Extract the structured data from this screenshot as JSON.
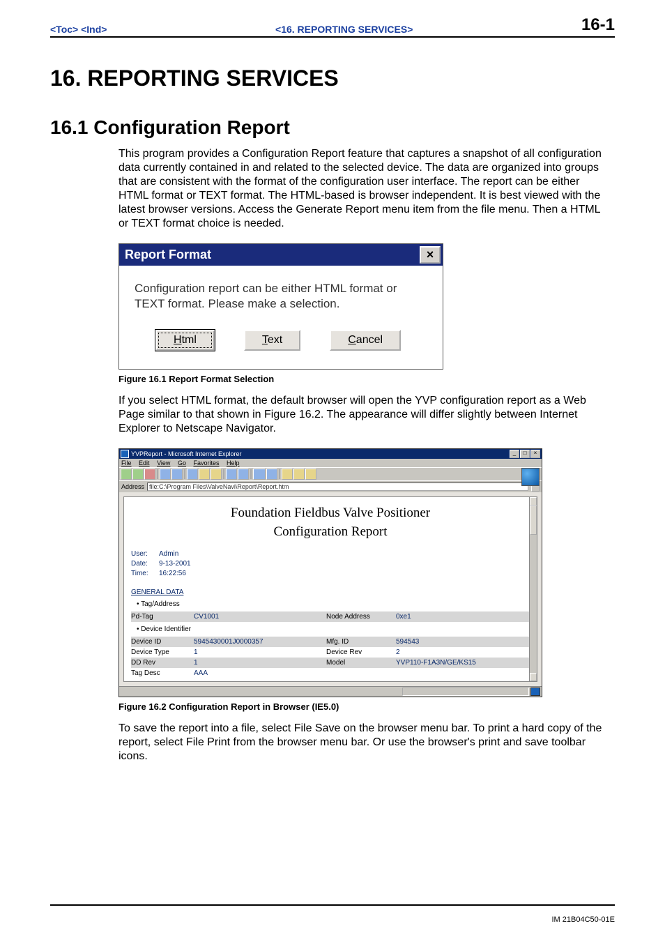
{
  "header": {
    "left_links": [
      "<Toc>",
      "<Ind>"
    ],
    "center": "<16.  REPORTING SERVICES>",
    "right": "16-1"
  },
  "chapter_title": "16.   REPORTING SERVICES",
  "section_title": "16.1  Configuration Report",
  "intro_paragraph": "This program provides a Configuration Report feature that captures a snapshot of all configuration data currently contained in and related to the selected device. The data are organized into groups that are consistent with the format of the configuration user interface. The report can be either HTML format or TEXT format. The HTML-based is browser independent. It is best viewed with the latest browser versions. Access the Generate Report menu item from the file menu. Then a HTML or TEXT format choice is needed.",
  "dialog": {
    "title": "Report Format",
    "close_label": "×",
    "message": "Configuration report can be either HTML format or TEXT format. Please make a selection.",
    "buttons": {
      "html_prefix": "H",
      "html_tail": "tml",
      "text_prefix": "T",
      "text_tail": "ext",
      "cancel_prefix": "C",
      "cancel_tail": "ancel"
    }
  },
  "fig1_caption": "Figure 16.1 Report Format Selection",
  "mid_paragraph": "If you select HTML format, the default browser will open the YVP configuration report as a Web Page similar to that shown in Figure 16.2.  The appearance will differ slightly between Internet Explorer to Netscape Navigator.",
  "browser": {
    "title": "YVPReport - Microsoft Internet Explorer",
    "menus": [
      "File",
      "Edit",
      "View",
      "Go",
      "Favorites",
      "Help"
    ],
    "address_label": "Address",
    "address_value": "file:C:\\Program Files\\ValveNavi\\Report\\Report.htm",
    "report_title_line1": "Foundation Fieldbus Valve Positioner",
    "report_title_line2": "Configuration Report",
    "meta": [
      {
        "label": "User:",
        "value": "Admin"
      },
      {
        "label": "Date:",
        "value": "9-13-2001"
      },
      {
        "label": "Time:",
        "value": "16:22:56"
      }
    ],
    "section_general": "GENERAL DATA",
    "bullet_tag_address": "Tag/Address",
    "tag_row": {
      "k1": "Pd-Tag",
      "v1": "CV1001",
      "k2": "Node Address",
      "v2": "0xe1"
    },
    "bullet_device_id": "Device Identifier",
    "dev_rows": [
      {
        "k1": "Device ID",
        "v1": "5945430001J0000357",
        "k2": "Mfg. ID",
        "v2": "594543"
      },
      {
        "k1": "Device Type",
        "v1": "1",
        "k2": "Device Rev",
        "v2": "2"
      },
      {
        "k1": "DD Rev",
        "v1": "1",
        "k2": "Model",
        "v2": "YVP110-F1A3N/GE/KS15"
      },
      {
        "k1": "Tag Desc",
        "v1": "AAA",
        "k2": "",
        "v2": ""
      }
    ]
  },
  "fig2_caption": "Figure 16.2 Configuration Report in Browser (IE5.0)",
  "tail_paragraph": "To save the report into a file, select File Save on the browser menu bar. To print a hard copy of the report, select File Print from the browser menu bar. Or use the browser's print and save toolbar icons.",
  "footer": "IM 21B04C50-01E"
}
